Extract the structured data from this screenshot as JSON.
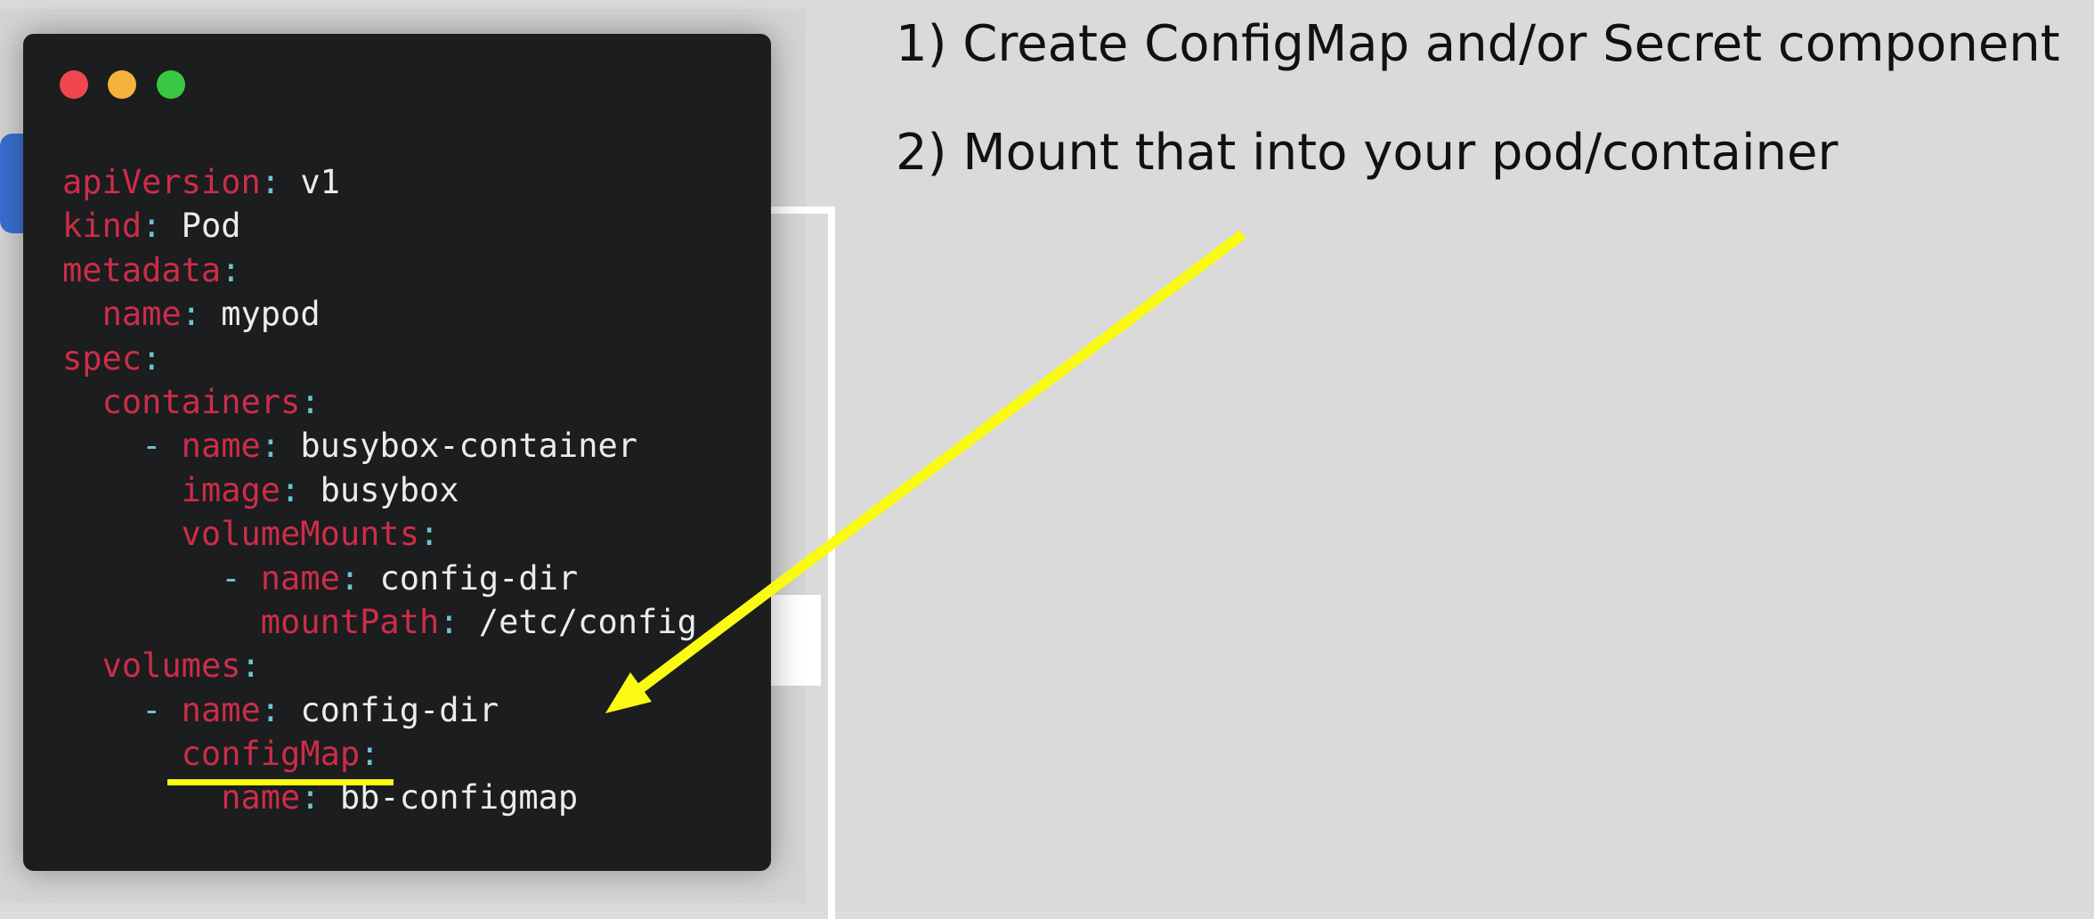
{
  "steps": [
    "1) Create ConfigMap and/or Secret component",
    "2) Mount that into your pod/container"
  ],
  "window_controls": [
    "close-dot",
    "minimize-dot",
    "maximize-dot"
  ],
  "colors": {
    "code_background": "#1b1d1e",
    "yaml_key": "#cc2d48",
    "yaml_punctuation": "#6dc3cf",
    "yaml_value": "#ececec",
    "annotation": "#fafa12",
    "dot_red": "#f0474e",
    "dot_yellow": "#f4b43c",
    "dot_green": "#3bc841"
  },
  "code_lines": [
    {
      "indent": "",
      "dash": "",
      "key": "apiVersion",
      "colon": ":",
      "value": " v1"
    },
    {
      "indent": "",
      "dash": "",
      "key": "kind",
      "colon": ":",
      "value": " Pod"
    },
    {
      "indent": "",
      "dash": "",
      "key": "metadata",
      "colon": ":",
      "value": ""
    },
    {
      "indent": "  ",
      "dash": "",
      "key": "name",
      "colon": ":",
      "value": " mypod"
    },
    {
      "indent": "",
      "dash": "",
      "key": "spec",
      "colon": ":",
      "value": ""
    },
    {
      "indent": "  ",
      "dash": "",
      "key": "containers",
      "colon": ":",
      "value": ""
    },
    {
      "indent": "    ",
      "dash": "- ",
      "key": "name",
      "colon": ":",
      "value": " busybox-container"
    },
    {
      "indent": "      ",
      "dash": "",
      "key": "image",
      "colon": ":",
      "value": " busybox"
    },
    {
      "indent": "      ",
      "dash": "",
      "key": "volumeMounts",
      "colon": ":",
      "value": ""
    },
    {
      "indent": "        ",
      "dash": "- ",
      "key": "name",
      "colon": ":",
      "value": " config-dir"
    },
    {
      "indent": "          ",
      "dash": "",
      "key": "mountPath",
      "colon": ":",
      "value": " /etc/config"
    },
    {
      "indent": "  ",
      "dash": "",
      "key": "volumes",
      "colon": ":",
      "value": ""
    },
    {
      "indent": "    ",
      "dash": "- ",
      "key": "name",
      "colon": ":",
      "value": " config-dir"
    },
    {
      "indent": "      ",
      "dash": "",
      "key": "configMap",
      "colon": ":",
      "value": ""
    },
    {
      "indent": "        ",
      "dash": "",
      "key": "name",
      "colon": ":",
      "value": " bb-configmap"
    }
  ]
}
